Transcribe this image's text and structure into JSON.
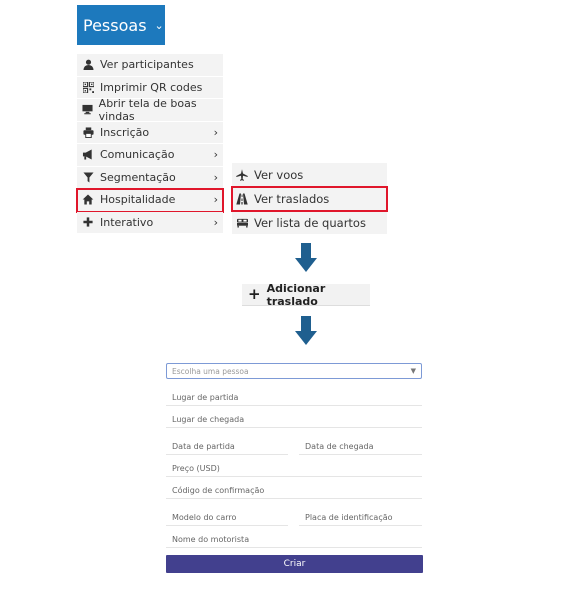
{
  "header": {
    "pessoas_label": "Pessoas"
  },
  "menu": {
    "items": [
      {
        "label": "Ver participantes",
        "icon": "person-icon"
      },
      {
        "label": "Imprimir QR codes",
        "icon": "qr-code-icon"
      },
      {
        "label": "Abrir tela de boas vindas",
        "icon": "monitor-icon"
      },
      {
        "label": "Inscrição",
        "icon": "printer-icon"
      },
      {
        "label": "Comunicação",
        "icon": "megaphone-icon"
      },
      {
        "label": "Segmentação",
        "icon": "filter-icon"
      },
      {
        "label": "Hospitalidade",
        "icon": "home-icon"
      },
      {
        "label": "Interativo",
        "icon": "plus-icon"
      }
    ]
  },
  "submenu": {
    "items": [
      {
        "label": "Ver voos",
        "icon": "plane-icon"
      },
      {
        "label": "Ver traslados",
        "icon": "road-icon"
      },
      {
        "label": "Ver lista de quartos",
        "icon": "bed-icon"
      }
    ]
  },
  "add_button": {
    "label": "Adicionar traslado"
  },
  "form": {
    "person_placeholder": "Escolha uma pessoa",
    "departure_place": "Lugar de partida",
    "arrival_place": "Lugar de chegada",
    "departure_date": "Data de partida",
    "arrival_date": "Data de chegada",
    "price": "Preço (USD)",
    "confirmation_code": "Código de confirmação",
    "car_model": "Modelo do carro",
    "plate": "Placa de identificação",
    "driver_name": "Nome do motorista",
    "submit_label": "Criar"
  },
  "colors": {
    "primary": "#1d79bd",
    "highlight": "#e0162b",
    "arrow": "#1f5f8f",
    "submit": "#42408e"
  }
}
